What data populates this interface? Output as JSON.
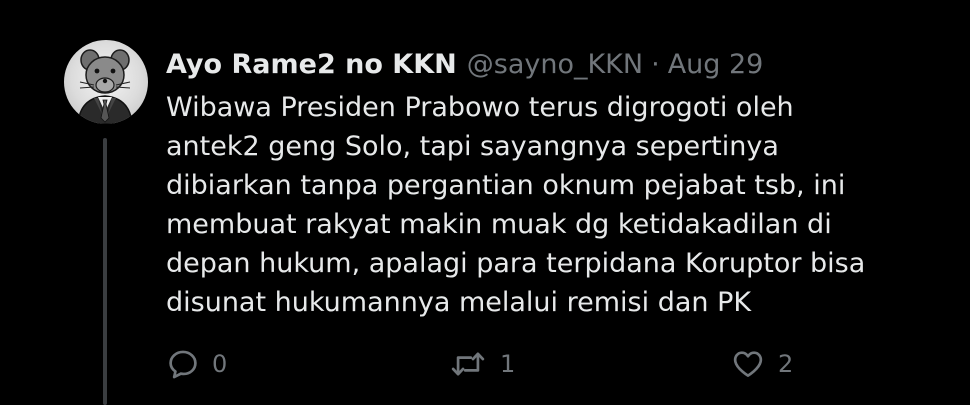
{
  "tweet": {
    "display_name": "Ayo Rame2 no KKN",
    "handle": "@sayno_KKN",
    "separator": "·",
    "date": "Aug 29",
    "avatar_icon": "rat-in-suit-avatar",
    "lines": [
      "Wibawa Presiden Prabowo terus digrogoti oleh",
      "antek2 geng Solo, tapi sayangnya sepertinya",
      "dibiarkan tanpa pergantian oknum pejabat tsb, ini",
      "membuat rakyat makin muak dg ketidakadilan di",
      "depan hukum, apalagi para terpidana Koruptor bisa",
      "disunat hukumannya melalui remisi dan PK"
    ]
  },
  "actions": {
    "reply": {
      "icon": "reply-icon",
      "count": "0"
    },
    "retweet": {
      "icon": "retweet-icon",
      "count": "1"
    },
    "like": {
      "icon": "heart-icon",
      "count": "2"
    }
  },
  "colors": {
    "background": "#000000",
    "primary_text": "#e7e9ea",
    "secondary_text": "#71767b",
    "thread_line": "#3a3d40"
  }
}
